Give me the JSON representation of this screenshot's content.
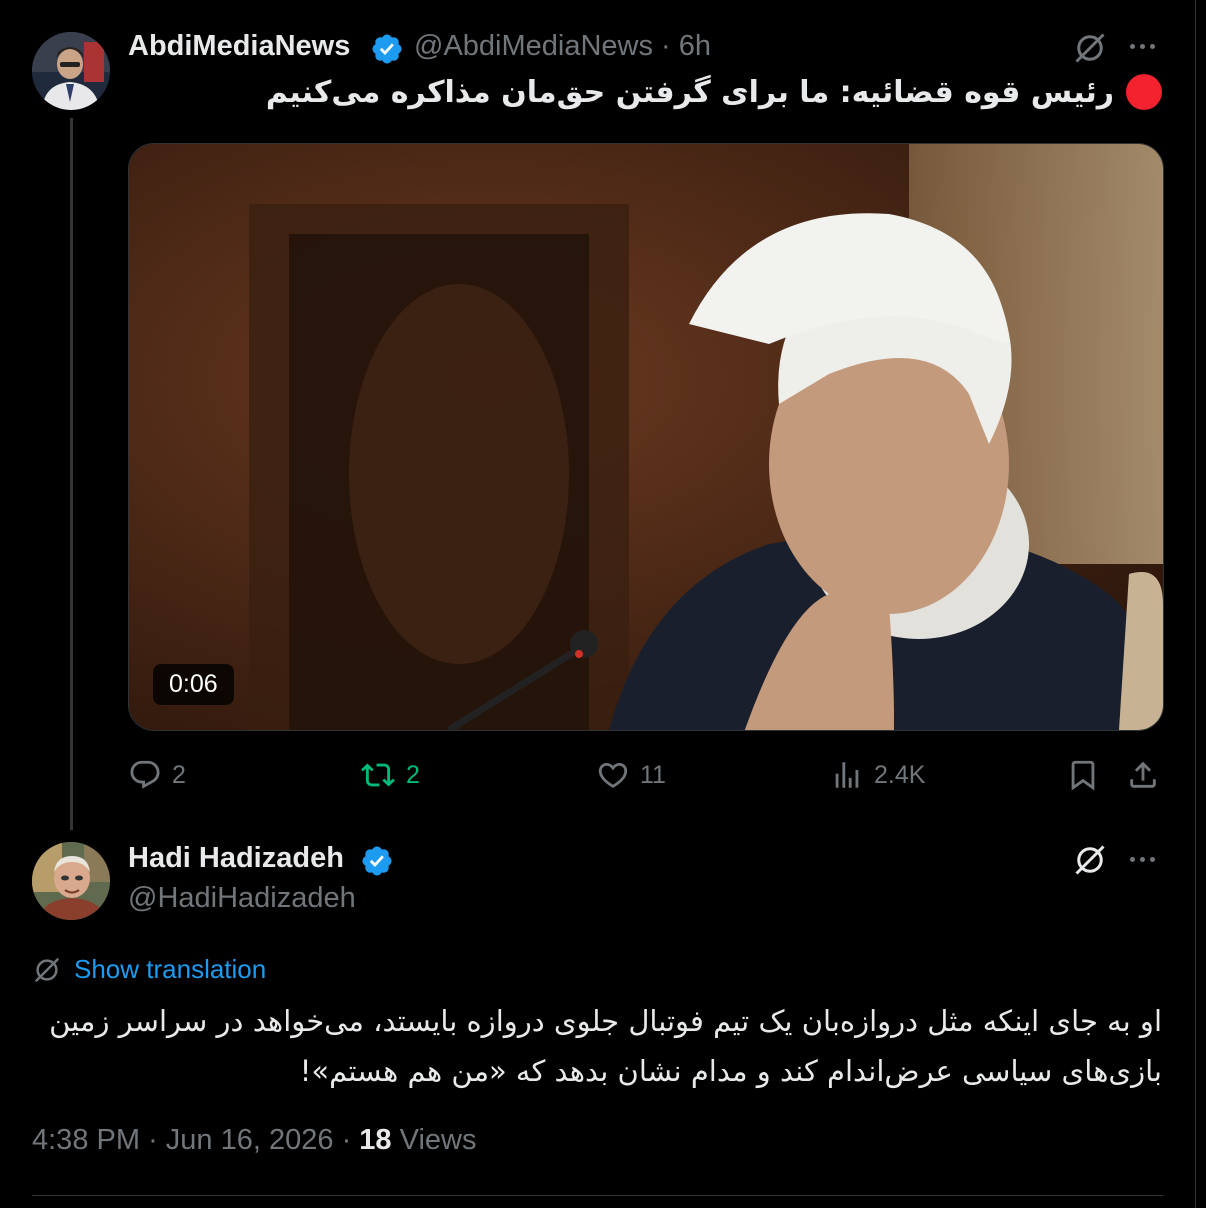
{
  "tweet1": {
    "display_name": "AbdiMediaNews",
    "handle": "@AbdiMediaNews",
    "separator": "·",
    "time": "6h",
    "text": "رئیس قوه قضائیه: ما برای گرفتن حق‌مان مذاکره می‌کنیم",
    "video_duration": "0:06",
    "replies": "2",
    "reposts": "2",
    "likes": "11",
    "views": "2.4K"
  },
  "tweet2": {
    "display_name": "Hadi Hadizadeh",
    "handle": "@HadiHadizadeh",
    "show_translation": "Show translation",
    "text": "او به جای اینکه مثل دروازه‌بان یک تیم فوتبال جلوی دروازه بایستد، می‌خواهد در سراسر زمین بازی‌های سیاسی عرض‌اندام کند و مدام نشان بدهد که «من هم هستم»!",
    "time": "4:38 PM",
    "date": "Jun 16, 2026",
    "separator": "·",
    "views_count": "18",
    "views_label": "Views"
  },
  "colors": {
    "background": "#000000",
    "text": "#e7e9ea",
    "muted": "#71767b",
    "accent": "#1d9bf0",
    "repost_green": "#00ba7c",
    "live_red": "#f4212e"
  },
  "icons": [
    "verified-badge-icon",
    "grok-icon",
    "more-icon",
    "reply-icon",
    "repost-icon",
    "like-icon",
    "views-icon",
    "bookmark-icon",
    "share-icon",
    "translate-icon"
  ]
}
